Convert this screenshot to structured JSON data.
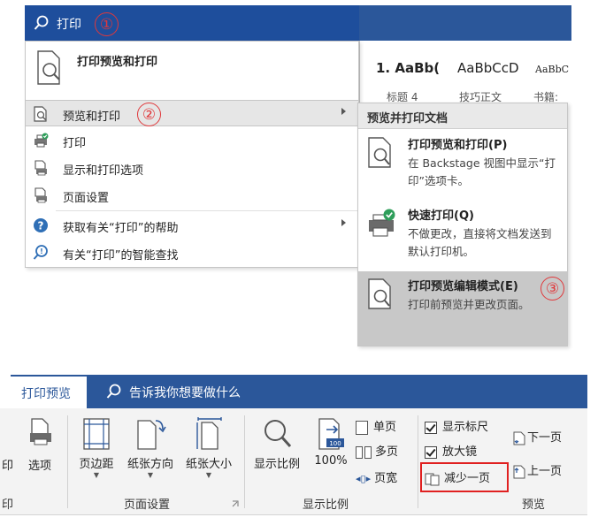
{
  "search": {
    "text": "打印"
  },
  "markers": [
    "①",
    "②",
    "③"
  ],
  "ribbon_preview": {
    "styles": [
      "1. AaBb(",
      "AaBbCcD",
      "AaBbC"
    ],
    "names": [
      "标题 4",
      "技巧正文",
      "书籍:"
    ]
  },
  "menu": {
    "header_item": "打印预览和打印",
    "items": [
      {
        "label": "预览和打印",
        "submenu": true
      },
      {
        "label": "打印"
      },
      {
        "label": "显示和打印选项"
      },
      {
        "label": "页面设置"
      },
      {
        "label": "获取有关“打印”的帮助",
        "submenu": true
      },
      {
        "label": "有关“打印”的智能查找"
      }
    ]
  },
  "submenu": {
    "header": "预览并打印文档",
    "items": [
      {
        "title": "打印预览和打印(P)",
        "desc": "在 Backstage 视图中显示“打印”选项卡。"
      },
      {
        "title": "快速打印(Q)",
        "desc": "不做更改，直接将文档发送到默认打印机。"
      },
      {
        "title": "打印预览编辑模式(E)",
        "desc": "打印前预览并更改页面。"
      }
    ]
  },
  "bottom": {
    "tab": "打印预览",
    "search": "告诉我你想要做什么",
    "buttons": {
      "options": "选项",
      "print_cut": "印",
      "margins": "页边距",
      "orientation": "纸张方向",
      "size": "纸张大小",
      "zoom": "显示比例",
      "percent": "100%",
      "one_page": "单页",
      "multi_page": "多页",
      "page_width": "页宽",
      "show_ruler": "显示标尺",
      "magnifier": "放大镜",
      "shrink_one_page": "减少一页",
      "next_page": "下一页",
      "prev_page": "上一页",
      "icon100": "100"
    },
    "groups": {
      "print_cut": "印",
      "page_setup": "页面设置",
      "zoom": "显示比例",
      "preview": "预览"
    }
  },
  "colors": {
    "word_blue": "#2b579a",
    "marker_red": "#e0383b",
    "highlight_red": "#e02020"
  }
}
